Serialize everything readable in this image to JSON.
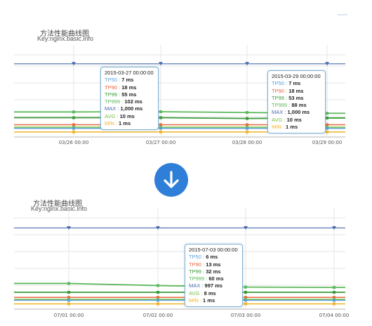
{
  "colors": {
    "tp50": "#5a9fd4",
    "tp90": "#e8693e",
    "tp99": "#3c9b3c",
    "tp999": "#5cb85c",
    "max": "#4a6aab",
    "avg": "#7ac142",
    "min": "#f0b429",
    "arrow_bg": "#2f7fd8"
  },
  "arrow_icon": "arrow-down-icon",
  "top": {
    "title": "方法性能曲线图",
    "subtitle": "Key:nginx.basic.info",
    "tooltips": [
      {
        "header": "2015-03-27 00:00:00",
        "rows": [
          {
            "label": "TP50",
            "value": "7 ms"
          },
          {
            "label": "TP90",
            "value": "18 ms"
          },
          {
            "label": "TP99",
            "value": "55 ms"
          },
          {
            "label": "TP999",
            "value": "102 ms"
          },
          {
            "label": "MAX",
            "value": "1,000 ms"
          },
          {
            "label": "AVG",
            "value": "10 ms"
          },
          {
            "label": "MIN",
            "value": "1 ms"
          }
        ]
      },
      {
        "header": "2015-03-29 00:00:00",
        "rows": [
          {
            "label": "TP50",
            "value": "7 ms"
          },
          {
            "label": "TP90",
            "value": "18 ms"
          },
          {
            "label": "TP99",
            "value": "53 ms"
          },
          {
            "label": "TP999",
            "value": "88 ms"
          },
          {
            "label": "MAX",
            "value": "1,000 ms"
          },
          {
            "label": "AVG",
            "value": "10 ms"
          },
          {
            "label": "MIN",
            "value": "1 ms"
          }
        ]
      }
    ]
  },
  "bottom": {
    "title": "方法性能曲线图",
    "subtitle": "Key:nginx.basic.info",
    "tooltips": [
      {
        "header": "2015-07-03 00:00:00",
        "rows": [
          {
            "label": "TP50",
            "value": "6 ms"
          },
          {
            "label": "TP90",
            "value": "13 ms"
          },
          {
            "label": "TP99",
            "value": "32 ms"
          },
          {
            "label": "TP999",
            "value": "60 ms"
          },
          {
            "label": "MAX",
            "value": "997 ms"
          },
          {
            "label": "AVG",
            "value": "8 ms"
          },
          {
            "label": "MIN",
            "value": "1 ms"
          }
        ]
      }
    ]
  },
  "chart_data": [
    {
      "type": "line",
      "title": "方法性能曲线图",
      "subtitle": "Key:nginx.basic.info",
      "x": [
        "03/26 00:00",
        "03/27 00:00",
        "03/28 00:00",
        "03/29 00:00"
      ],
      "ylim": [
        0,
        1100
      ],
      "series": [
        {
          "name": "TP50",
          "values": [
            7,
            7,
            7,
            7
          ]
        },
        {
          "name": "TP90",
          "values": [
            18,
            18,
            18,
            18
          ]
        },
        {
          "name": "TP99",
          "values": [
            55,
            55,
            50,
            53
          ]
        },
        {
          "name": "TP999",
          "values": [
            100,
            102,
            95,
            88
          ]
        },
        {
          "name": "MAX",
          "values": [
            1000,
            1000,
            1000,
            1000
          ]
        },
        {
          "name": "AVG",
          "values": [
            10,
            10,
            10,
            10
          ]
        },
        {
          "name": "MIN",
          "values": [
            1,
            1,
            1,
            1
          ]
        }
      ]
    },
    {
      "type": "line",
      "title": "方法性能曲线图",
      "subtitle": "Key:nginx.basic.info",
      "x": [
        "07/01 00:00",
        "07/02 00:00",
        "07/03 00:00",
        "07/04 00:00"
      ],
      "ylim": [
        0,
        1100
      ],
      "series": [
        {
          "name": "TP50",
          "values": [
            6,
            6,
            6,
            6
          ]
        },
        {
          "name": "TP90",
          "values": [
            13,
            13,
            13,
            13
          ]
        },
        {
          "name": "TP99",
          "values": [
            32,
            32,
            32,
            32
          ]
        },
        {
          "name": "TP999",
          "values": [
            85,
            70,
            60,
            58
          ]
        },
        {
          "name": "MAX",
          "values": [
            997,
            997,
            997,
            997
          ]
        },
        {
          "name": "AVG",
          "values": [
            8,
            8,
            8,
            8
          ]
        },
        {
          "name": "MIN",
          "values": [
            1,
            1,
            1,
            1
          ]
        }
      ]
    }
  ]
}
